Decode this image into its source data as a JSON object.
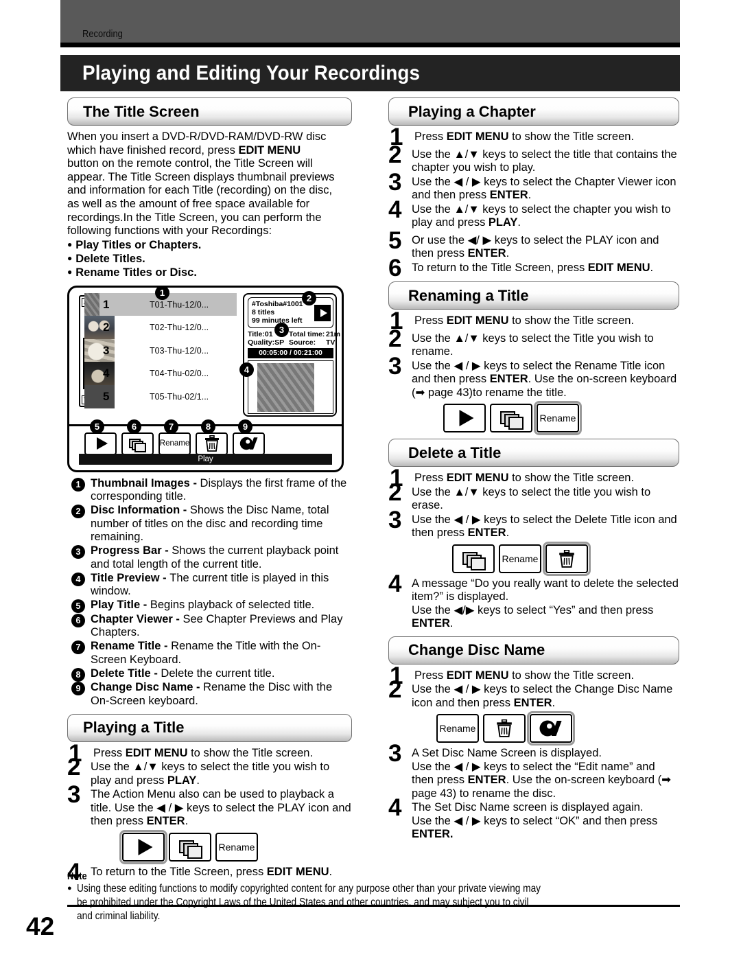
{
  "header": {
    "running_head": "Recording",
    "chapter_title": "Playing and Editing Your Recordings"
  },
  "page_number": "42",
  "left_column": {
    "title_screen": {
      "heading": "The Title Screen",
      "paragraph_lines": [
        "When you insert a DVD-R/DVD-RAM/DVD-RW disc",
        "which have finished record, press EDIT MENU",
        "button on the remote control, the Title Screen will",
        "appear. The Title Screen displays thumbnail previews",
        "and information for each Title (recording) on the disc,",
        "as well as the amount of free space available for",
        "recordings.In the Title Screen, you can perform the",
        "following functions with your Recordings:"
      ],
      "bullets": [
        "Play Titles or Chapters.",
        "Delete Titles.",
        "Rename Titles or Disc."
      ]
    },
    "tv_screen": {
      "titles": [
        {
          "index": "1",
          "name": "T01-Thu-12/0..."
        },
        {
          "index": "2",
          "name": "T02-Thu-12/0..."
        },
        {
          "index": "3",
          "name": "T03-Thu-12/0..."
        },
        {
          "index": "4",
          "name": "T04-Thu-02/0..."
        },
        {
          "index": "5",
          "name": "T05-Thu-02/1..."
        }
      ],
      "disc_info": {
        "disc_name": "#Toshiba#1001",
        "title_count": "8 titles",
        "time_left": "99 minutes left"
      },
      "meta": {
        "title_label": "Title:01",
        "total_time_label": "Total time:",
        "total_time_value": "21m",
        "quality_label": "Quality:SP",
        "source_label": "Source:",
        "source_value": "TV"
      },
      "progress": "00:05:00 / 00:21:00",
      "buttons": [
        {
          "id": "play",
          "label": ""
        },
        {
          "id": "chapter-viewer",
          "label": ""
        },
        {
          "id": "rename",
          "label": "Rename"
        },
        {
          "id": "delete",
          "label": ""
        },
        {
          "id": "change-disc-name",
          "label": ""
        }
      ],
      "status_strip": "Play",
      "callouts": [
        "1",
        "2",
        "3",
        "4",
        "5",
        "6",
        "7",
        "8",
        "9"
      ]
    },
    "legend": [
      {
        "num": "1",
        "term": "Thumbnail Images - ",
        "desc": "Displays the first frame of the corresponding title."
      },
      {
        "num": "2",
        "term": "Disc Information - ",
        "desc": "Shows the Disc Name, total number of titles on the disc and recording time remaining."
      },
      {
        "num": "3",
        "term": "Progress Bar - ",
        "desc": "Shows the current playback point and total length of the current title."
      },
      {
        "num": "4",
        "term": "Title Preview - ",
        "desc": "The current title is played in this window."
      },
      {
        "num": "5",
        "term": "Play Title - ",
        "desc": "Begins playback of selected title."
      },
      {
        "num": "6",
        "term": "Chapter Viewer - ",
        "desc": "See Chapter Previews and Play Chapters."
      },
      {
        "num": "7",
        "term": "Rename Title - ",
        "desc": "Rename the Title with the On-Screen Keyboard."
      },
      {
        "num": "8",
        "term": "Delete Title - ",
        "desc": "Delete the current title."
      },
      {
        "num": "9",
        "term": "Change Disc Name - ",
        "desc": "Rename the Disc with the On-Screen keyboard."
      }
    ],
    "playing_a_title": {
      "heading": "Playing a Title",
      "steps": [
        {
          "num": "1",
          "html": "Press <b>EDIT MENU</b> to show the Title screen."
        },
        {
          "num": "2",
          "html": "Use the ▲/▼ keys to select the title you wish to play and press <b>PLAY</b>."
        },
        {
          "num": "3",
          "html": "The Action Menu also can be used to playback a title. Use the ◀ / ▶ keys to select the PLAY icon and then press <b>ENTER</b>."
        },
        {
          "num": "4",
          "html": "To return to the Title Screen, press <b>EDIT MENU</b>."
        }
      ],
      "icons": [
        {
          "id": "play",
          "label": "",
          "selected": true
        },
        {
          "id": "chapter-viewer",
          "label": "",
          "selected": false
        },
        {
          "id": "rename",
          "label": "Rename",
          "selected": false
        }
      ]
    }
  },
  "right_column": {
    "playing_a_chapter": {
      "heading": "Playing a Chapter",
      "steps": [
        {
          "num": "1",
          "html": "Press <b>EDIT MENU</b> to show the Title screen."
        },
        {
          "num": "2",
          "html": "Use the ▲/▼ keys to select the title that contains the chapter you wish to play."
        },
        {
          "num": "3",
          "html": "Use the ◀ / ▶ keys to select the Chapter Viewer icon and then press <b>ENTER</b>."
        },
        {
          "num": "4",
          "html": "Use the ▲/▼ keys to select the chapter you wish to play and press <b>PLAY</b>."
        },
        {
          "num": "5",
          "html": "Or use the ◀/ ▶ keys to select the PLAY icon and then press <b>ENTER</b>."
        },
        {
          "num": "6",
          "html": "To return to the Title Screen, press <b>EDIT MENU</b>."
        }
      ]
    },
    "renaming_a_title": {
      "heading": "Renaming a Title",
      "steps": [
        {
          "num": "1",
          "html": "Press <b>EDIT MENU</b> to show the Title screen."
        },
        {
          "num": "2",
          "html": "Use the ▲/▼ keys to select the Title you wish to rename."
        },
        {
          "num": "3",
          "html": "Use the ◀ / ▶ keys to select the Rename Title icon and then press <b>ENTER</b>. Use the on-screen keyboard (➡ page 43)to rename the title."
        }
      ],
      "page_ref": "page 43",
      "icons": [
        {
          "id": "play",
          "label": "",
          "selected": false
        },
        {
          "id": "chapter-viewer",
          "label": "",
          "selected": false
        },
        {
          "id": "rename",
          "label": "Rename",
          "selected": true
        }
      ]
    },
    "delete_a_title": {
      "heading": "Delete a Title",
      "steps": [
        {
          "num": "1",
          "html": "Press <b>EDIT MENU</b> to show the Title screen."
        },
        {
          "num": "2",
          "html": "Use the ▲/▼ keys to select the title you wish to erase."
        },
        {
          "num": "3",
          "html": "Use the ◀ / ▶ keys to select the Delete Title icon and then press <b>ENTER</b>."
        },
        {
          "num": "4",
          "html": "A message “Do you really want to delete the selected item?” is displayed.<br>Use the ◀/▶ keys to select “Yes” and then press <b>ENTER</b>."
        }
      ],
      "icons": [
        {
          "id": "chapter-viewer",
          "label": "",
          "selected": false
        },
        {
          "id": "rename",
          "label": "Rename",
          "selected": false
        },
        {
          "id": "delete",
          "label": "",
          "selected": true
        }
      ]
    },
    "change_disc_name": {
      "heading": "Change Disc Name",
      "steps": [
        {
          "num": "1",
          "html": "Press <b>EDIT MENU</b> to show the Title screen."
        },
        {
          "num": "2",
          "html": "Use the ◀ / ▶ keys to select the Change Disc Name icon and then press <b>ENTER</b>."
        },
        {
          "num": "3",
          "html": "A Set Disc Name Screen is displayed.<br>Use the ◀ / ▶ keys to select the “Edit name” and then press <b>ENTER</b>. Use the on-screen keyboard (➡ page 43) to rename the disc."
        },
        {
          "num": "4",
          "html": "The Set Disc Name screen is displayed again.<br>Use the ◀ / ▶ keys to select “OK” and then press <b>ENTER.</b>"
        }
      ],
      "icons": [
        {
          "id": "rename",
          "label": "Rename",
          "selected": false
        },
        {
          "id": "delete",
          "label": "",
          "selected": false
        },
        {
          "id": "change-disc-name",
          "label": "",
          "selected": true
        }
      ]
    }
  },
  "note": {
    "heading": "Note",
    "lines": [
      "Using these editing functions to modify copyrighted content for any purpose other than your private viewing may",
      "be prohibited under the Copyright Laws of the United States and other countries, and may subject you to civil",
      "and criminal liability."
    ]
  }
}
